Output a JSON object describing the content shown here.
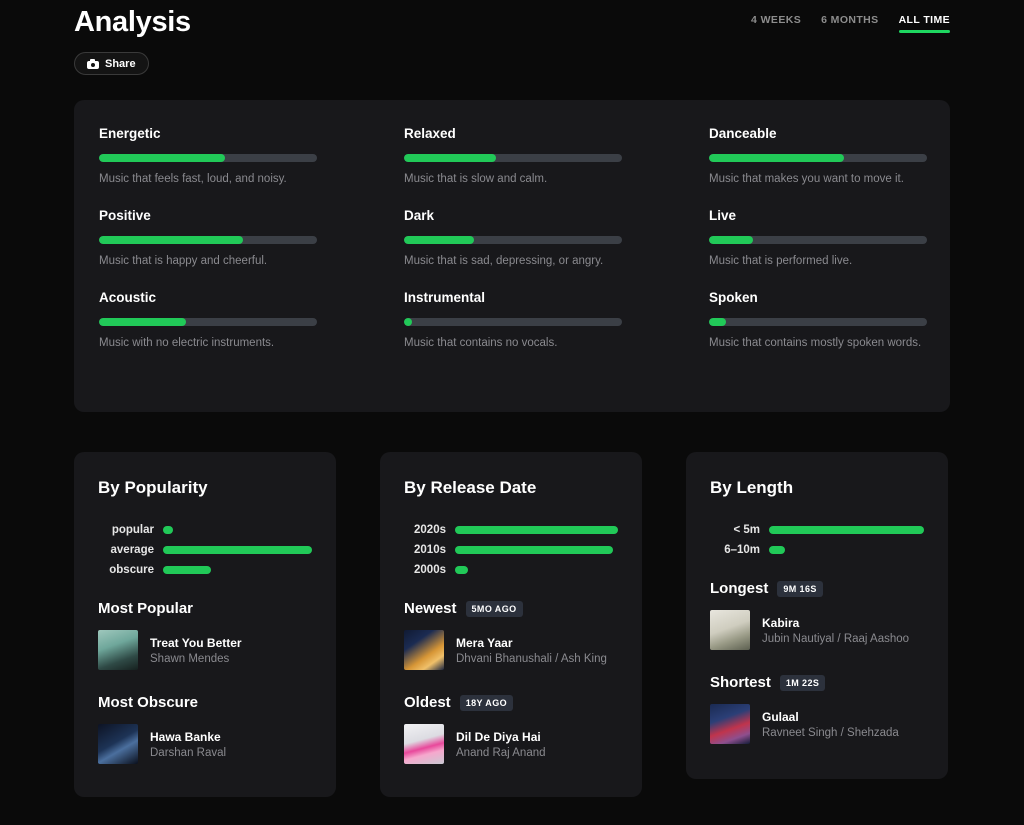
{
  "header": {
    "title": "Analysis",
    "share_label": "Share",
    "share_icon": "camera-icon",
    "ranges": [
      {
        "label": "4 WEEKS",
        "active": false
      },
      {
        "label": "6 MONTHS",
        "active": false
      },
      {
        "label": "ALL TIME",
        "active": true
      }
    ]
  },
  "colors": {
    "accent": "#21c958",
    "accent_bright": "#1ed760",
    "card_bg": "#18181b",
    "page_bg": "#0a0a0a",
    "track_bg": "#3b3f46",
    "muted_text": "#8a8a8f"
  },
  "attributes": [
    {
      "name": "Energetic",
      "percent": 58,
      "desc": "Music that feels fast, loud, and noisy."
    },
    {
      "name": "Relaxed",
      "percent": 42,
      "desc": "Music that is slow and calm."
    },
    {
      "name": "Danceable",
      "percent": 62,
      "desc": "Music that makes you want to move it."
    },
    {
      "name": "Positive",
      "percent": 66,
      "desc": "Music that is happy and cheerful."
    },
    {
      "name": "Dark",
      "percent": 32,
      "desc": "Music that is sad, depressing, or angry."
    },
    {
      "name": "Live",
      "percent": 20,
      "desc": "Music that is performed live."
    },
    {
      "name": "Acoustic",
      "percent": 40,
      "desc": "Music with no electric instruments."
    },
    {
      "name": "Instrumental",
      "percent": 2,
      "desc": "Music that contains no vocals."
    },
    {
      "name": "Spoken",
      "percent": 8,
      "desc": "Music that contains mostly spoken words."
    }
  ],
  "popularity": {
    "title": "By Popularity",
    "bars": [
      {
        "label": "popular",
        "percent": 3
      },
      {
        "label": "average",
        "percent": 100
      },
      {
        "label": "obscure",
        "percent": 32
      }
    ],
    "sections": [
      {
        "title": "Most Popular",
        "badge": "",
        "track": {
          "name": "Treat You Better",
          "artist": "Shawn Mendes",
          "art": "treat-you-better-cover"
        }
      },
      {
        "title": "Most Obscure",
        "badge": "",
        "track": {
          "name": "Hawa Banke",
          "artist": "Darshan Raval",
          "art": "hawa-banke-cover"
        }
      }
    ]
  },
  "release_date": {
    "title": "By Release Date",
    "bars": [
      {
        "label": "2020s",
        "percent": 100
      },
      {
        "label": "2010s",
        "percent": 97
      },
      {
        "label": "2000s",
        "percent": 8
      }
    ],
    "sections": [
      {
        "title": "Newest",
        "badge": "5MO AGO",
        "track": {
          "name": "Mera Yaar",
          "artist": "Dhvani Bhanushali / Ash King",
          "art": "mera-yaar-cover"
        }
      },
      {
        "title": "Oldest",
        "badge": "18Y AGO",
        "track": {
          "name": "Dil De Diya Hai",
          "artist": "Anand Raj Anand",
          "art": "dil-de-diya-hai-cover"
        }
      }
    ]
  },
  "length": {
    "title": "By Length",
    "bars": [
      {
        "label": "< 5m",
        "percent": 100
      },
      {
        "label": "6–10m",
        "percent": 10
      }
    ],
    "sections": [
      {
        "title": "Longest",
        "badge": "9M 16S",
        "track": {
          "name": "Kabira",
          "artist": "Jubin Nautiyal / Raaj Aashoo",
          "art": "kabira-cover"
        }
      },
      {
        "title": "Shortest",
        "badge": "1M 22S",
        "track": {
          "name": "Gulaal",
          "artist": "Ravneet Singh / Shehzada",
          "art": "gulaal-cover"
        }
      }
    ]
  }
}
